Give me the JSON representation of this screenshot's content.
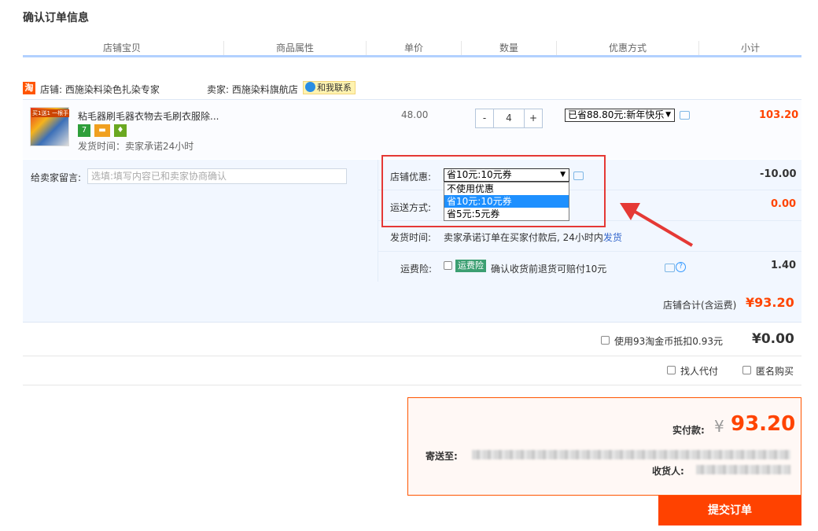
{
  "page": {
    "title": "确认订单信息"
  },
  "columns": [
    "店铺宝贝",
    "商品属性",
    "单价",
    "数量",
    "优惠方式",
    "小计"
  ],
  "shop": {
    "icon_text": "淘",
    "store_label": "店铺: 西施染料染色扎染专家",
    "seller_label": "卖家: 西施染料旗航店",
    "contact_label": "和我联系"
  },
  "item": {
    "thumb_text": "买1送1 一根手",
    "title": "粘毛器刷毛器衣物去毛刷衣服除...",
    "badges": [
      {
        "text": "7",
        "color": "#2e9e3a"
      },
      {
        "text": "▬",
        "color": "#f0a020"
      },
      {
        "text": "♦",
        "color": "#6aa820"
      }
    ],
    "ship_promise": "发货时间：卖家承诺24小时",
    "unit_price": "48.00",
    "quantity": "4",
    "minus": "-",
    "plus": "+",
    "discount_select": "已省88.80元:新年快乐",
    "subtotal": "103.20"
  },
  "message": {
    "label": "给卖家留言:",
    "placeholder": "选填:填写内容已和卖家协商确认"
  },
  "shop_coupon": {
    "label": "店铺优惠:",
    "selected": "省10元:10元券",
    "options": [
      "不使用优惠",
      "省10元:10元券",
      "省5元:5元券"
    ],
    "value": "-10.00"
  },
  "shipping": {
    "label": "运送方式:",
    "value": "0.00"
  },
  "delivery": {
    "label": "发货时间:",
    "text": "卖家承诺订单在买家付款后, 24小时内",
    "link": "发货"
  },
  "insurance": {
    "label": "运费险:",
    "tag": "运费险",
    "text": "确认收货前退货可赔付10元",
    "value": "1.40"
  },
  "shop_total": {
    "label": "店铺合计(含运费)",
    "value": "¥93.20"
  },
  "coins": {
    "label": "使用93淘金币抵扣0.93元",
    "value": "¥0.00"
  },
  "extras": {
    "proxy_pay": "找人代付",
    "anonymous": "匿名购买"
  },
  "payment": {
    "label": "实付款:",
    "currency": "¥",
    "amount": "93.20",
    "ship_to_label": "寄送至:",
    "receiver_label": "收货人:"
  },
  "submit_label": "提交订单",
  "colors": {
    "accent": "#ff4400",
    "annotation": "#e53935",
    "select_highlight": "#1e90ff"
  }
}
